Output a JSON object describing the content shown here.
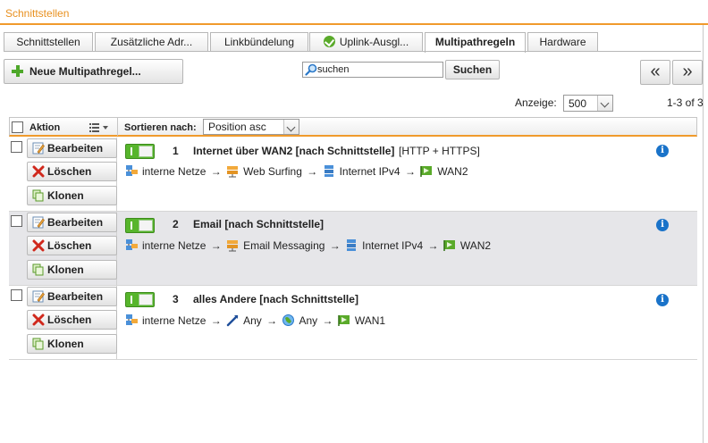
{
  "window": {
    "title": "Schnittstellen"
  },
  "tabs": [
    {
      "label": "Schnittstellen",
      "active": false
    },
    {
      "label": "Zusätzliche Adr...",
      "active": false
    },
    {
      "label": "Linkbündelung",
      "active": false
    },
    {
      "label": "Uplink-Ausgl...",
      "active": false,
      "icon": "status-ok-icon"
    },
    {
      "label": "Multipathregeln",
      "active": true
    },
    {
      "label": "Hardware",
      "active": false
    }
  ],
  "toolbar": {
    "new_button_label": "Neue Multipathregel...",
    "search_value": "suchen",
    "search_button_label": "Suchen",
    "prev_label": "«",
    "next_label": "»"
  },
  "paging": {
    "anzeige_label": "Anzeige:",
    "page_size": "500",
    "count_text": "1-3 of 3"
  },
  "table": {
    "action_header": "Aktion",
    "sort_label": "Sortieren nach:",
    "sort_value": "Position asc",
    "action_labels": {
      "edit": "Bearbeiten",
      "delete": "Löschen",
      "clone": "Klonen"
    },
    "arrow": "→",
    "rows": [
      {
        "number": "1",
        "name": "Internet über WAN2 [nach Schnittstelle]",
        "services": "[HTTP + HTTPS]",
        "enabled": true,
        "chain": {
          "source": "interne Netze",
          "service": "Web Surfing",
          "destination": "Internet IPv4",
          "interface": "WAN2"
        }
      },
      {
        "number": "2",
        "name": "Email [nach Schnittstelle]",
        "services": "",
        "enabled": true,
        "chain": {
          "source": "interne Netze",
          "service": "Email Messaging",
          "destination": "Internet IPv4",
          "interface": "WAN2"
        }
      },
      {
        "number": "3",
        "name": "alles Andere [nach Schnittstelle]",
        "services": "",
        "enabled": true,
        "chain": {
          "source": "interne Netze",
          "service": "Any",
          "destination": "Any",
          "interface": "WAN1"
        }
      }
    ]
  },
  "colors": {
    "accent": "#f09a2c",
    "title_text": "#e8901f",
    "toggle_on": "#57b52c",
    "info": "#1a73c9",
    "row_alt": "#e6e6e9"
  }
}
